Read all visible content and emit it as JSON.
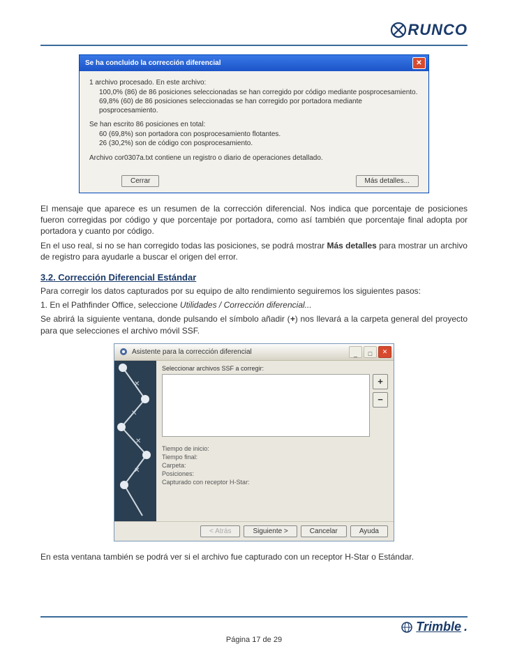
{
  "header": {
    "brand": "RUNCO"
  },
  "dialog1": {
    "title": "Se ha concluido la corrección diferencial",
    "line1": "1 archivo procesado. En este archivo:",
    "line1a": "100,0% (86) de 86 posiciones seleccionadas se han corregido por código mediante posprocesamiento.",
    "line1b": "69,8% (60) de 86 posiciones seleccionadas se han corregido por portadora mediante posprocesamiento.",
    "line2": "Se han escrito 86 posiciones en total:",
    "line2a": "60 (69,8%) son portadora con posprocesamiento flotantes.",
    "line2b": "26 (30,2%) son de código con posprocesamiento.",
    "line3": "Archivo cor0307a.txt contiene un registro o diario de operaciones detallado.",
    "btn_close": "Cerrar",
    "btn_more": "Más detalles..."
  },
  "para1a": "El mensaje que aparece es un resumen de la corrección diferencial. Nos indica que porcentaje de posiciones fueron corregidas por código y que porcentaje por portadora, como así también que porcentaje final adopta por portadora y cuanto por código.",
  "para1b_pre": "En el uso real, si no se han corregido todas las posiciones, se podrá mostrar ",
  "para1b_bold": "Más detalles",
  "para1b_post": " para mostrar un archivo de registro para ayudarle a buscar el origen del error.",
  "section_heading": "3.2. Corrección Diferencial Estándar",
  "para2": "Para corregir los datos capturados por su equipo de alto rendimiento seguiremos los siguientes pasos:",
  "step1_pre": "1. En el Pathfinder Office,  seleccione ",
  "step1_italic": "Utilidades / Corrección diferencial...",
  "para3_pre": "Se abrirá la siguiente ventana, donde pulsando el símbolo añadir (",
  "para3_plus": "+",
  "para3_post": ") nos llevará a la carpeta general del proyecto para que selecciones el archivo móvil SSF.",
  "dialog2": {
    "title": "Asistente para la corrección diferencial",
    "label_select": "Seleccionar archivos SSF a corregir:",
    "info_start": "Tiempo de inicio:",
    "info_end": "Tiempo final:",
    "info_folder": "Carpeta:",
    "info_pos": "Posiciones:",
    "info_hstar": "Capturado con receptor H-Star:",
    "btn_back": "< Atrás",
    "btn_next": "Siguiente >",
    "btn_cancel": "Cancelar",
    "btn_help": "Ayuda"
  },
  "para4": "En esta ventana también se podrá ver si el archivo fue capturado con un receptor H-Star o Estándar.",
  "footer": {
    "brand2": "Trimble",
    "page_pre": "Página ",
    "page_num": "17",
    "page_mid": " de ",
    "page_total": "29"
  }
}
